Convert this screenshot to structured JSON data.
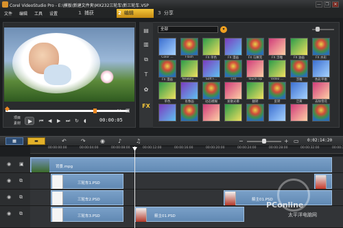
{
  "window": {
    "title": "Corel VideoStudio Pro - E:\\模板\\新建文件夹\\MX232三轮车\\新三轮车.VSP",
    "minimize": "—",
    "restore": "❐",
    "close": "✕"
  },
  "menu": [
    "文件",
    "编辑",
    "工具",
    "设置"
  ],
  "steps": [
    {
      "num": "1",
      "label": "捕获"
    },
    {
      "num": "2",
      "label": "编辑"
    },
    {
      "num": "3",
      "label": "分享"
    }
  ],
  "preview": {
    "project_label": "项目",
    "clip_label": "素材",
    "timecode": "00:00:05",
    "play_icon": "▶"
  },
  "library": {
    "category": "全部",
    "category_arrow": "▾",
    "side_icons": [
      "media-icon",
      "instant-project-icon",
      "transition-icon",
      "title-icon",
      "graphic-icon",
      "fx-icon"
    ],
    "fx_label": "FX",
    "thumbnails": [
      [
        "Color ...",
        "Flash",
        "FX 单色",
        "FX 漫画",
        "FX 马赛克",
        "FX 浮雕",
        "FX 油画",
        "FX 水彩"
      ],
      [
        "FX 漫画",
        "NewBlu...",
        "Soft F...",
        "Tint",
        "Touch Up",
        "Video ...",
        "浮雕",
        "色彩平衡"
      ],
      [
        "单色",
        "肖像画",
        "动态模糊",
        "发散光晕",
        "翻转",
        "反转",
        "泛黄",
        "去除雪花"
      ],
      [
        "",
        "",
        "",
        "",
        "",
        "",
        "",
        ""
      ]
    ]
  },
  "timeline": {
    "view_btn": "▦",
    "timeline_btn": "▬",
    "timecode": "0:02:14:20",
    "ruler": [
      "00:00:00:00",
      "00:00:04:00",
      "00:00:08:00",
      "00:00:12:00",
      "00:00:16:00",
      "00:00:20:00",
      "00:00:24:00",
      "00:00:28:00",
      "00:00:32:00",
      "00:00:36:00"
    ],
    "tracks": [
      {
        "clips": [
          {
            "label": "背景.mpg"
          }
        ]
      },
      {
        "clips": [
          {
            "label": "三轮车1.PSD"
          }
        ]
      },
      {
        "clips": [
          {
            "label": "三轮车2.PSD"
          },
          {
            "label": "箭主01.PSD"
          }
        ]
      },
      {
        "clips": [
          {
            "label": "三轮车3.PSD"
          },
          {
            "label": "箭主01.PSD"
          }
        ]
      }
    ]
  },
  "watermark": {
    "brand": "PConline",
    "sub": "太平洋电脑网"
  }
}
